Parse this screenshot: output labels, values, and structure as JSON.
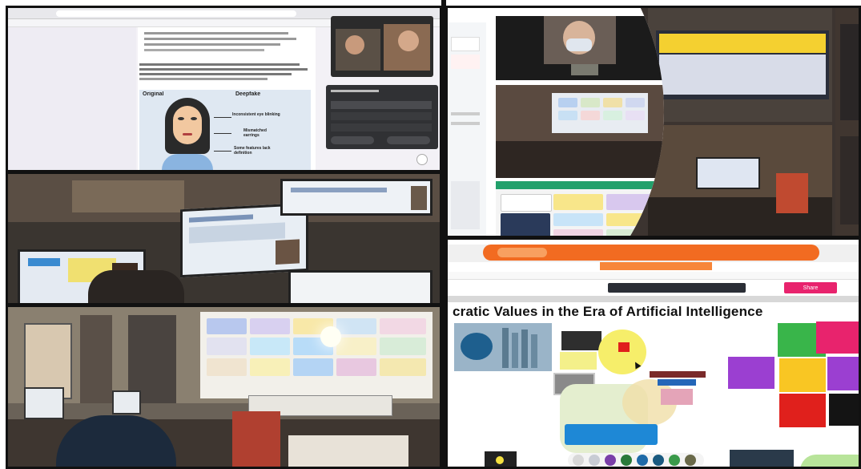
{
  "collage": {
    "panel1": {
      "diagram_labels": {
        "original": "Original",
        "deepfake": "Deepfake",
        "inconsistent": "Inconsistent eye blinking",
        "mismatched": "Mismatched earrings",
        "some_features": "Some features lack definition"
      }
    },
    "panel5": {
      "banner_title": "cratic Values in the Era of Artificial Intelligence",
      "toolbar_button": "Share"
    }
  },
  "colors": {
    "frame": "#111111",
    "accent_orange": "#f26b21",
    "note_pink": "#e8236d",
    "note_green": "#39b54a",
    "note_purple": "#9b3fd1",
    "note_yellow": "#f9c623",
    "note_red": "#e0201c",
    "highlight_yellow": "#f4f08a"
  }
}
